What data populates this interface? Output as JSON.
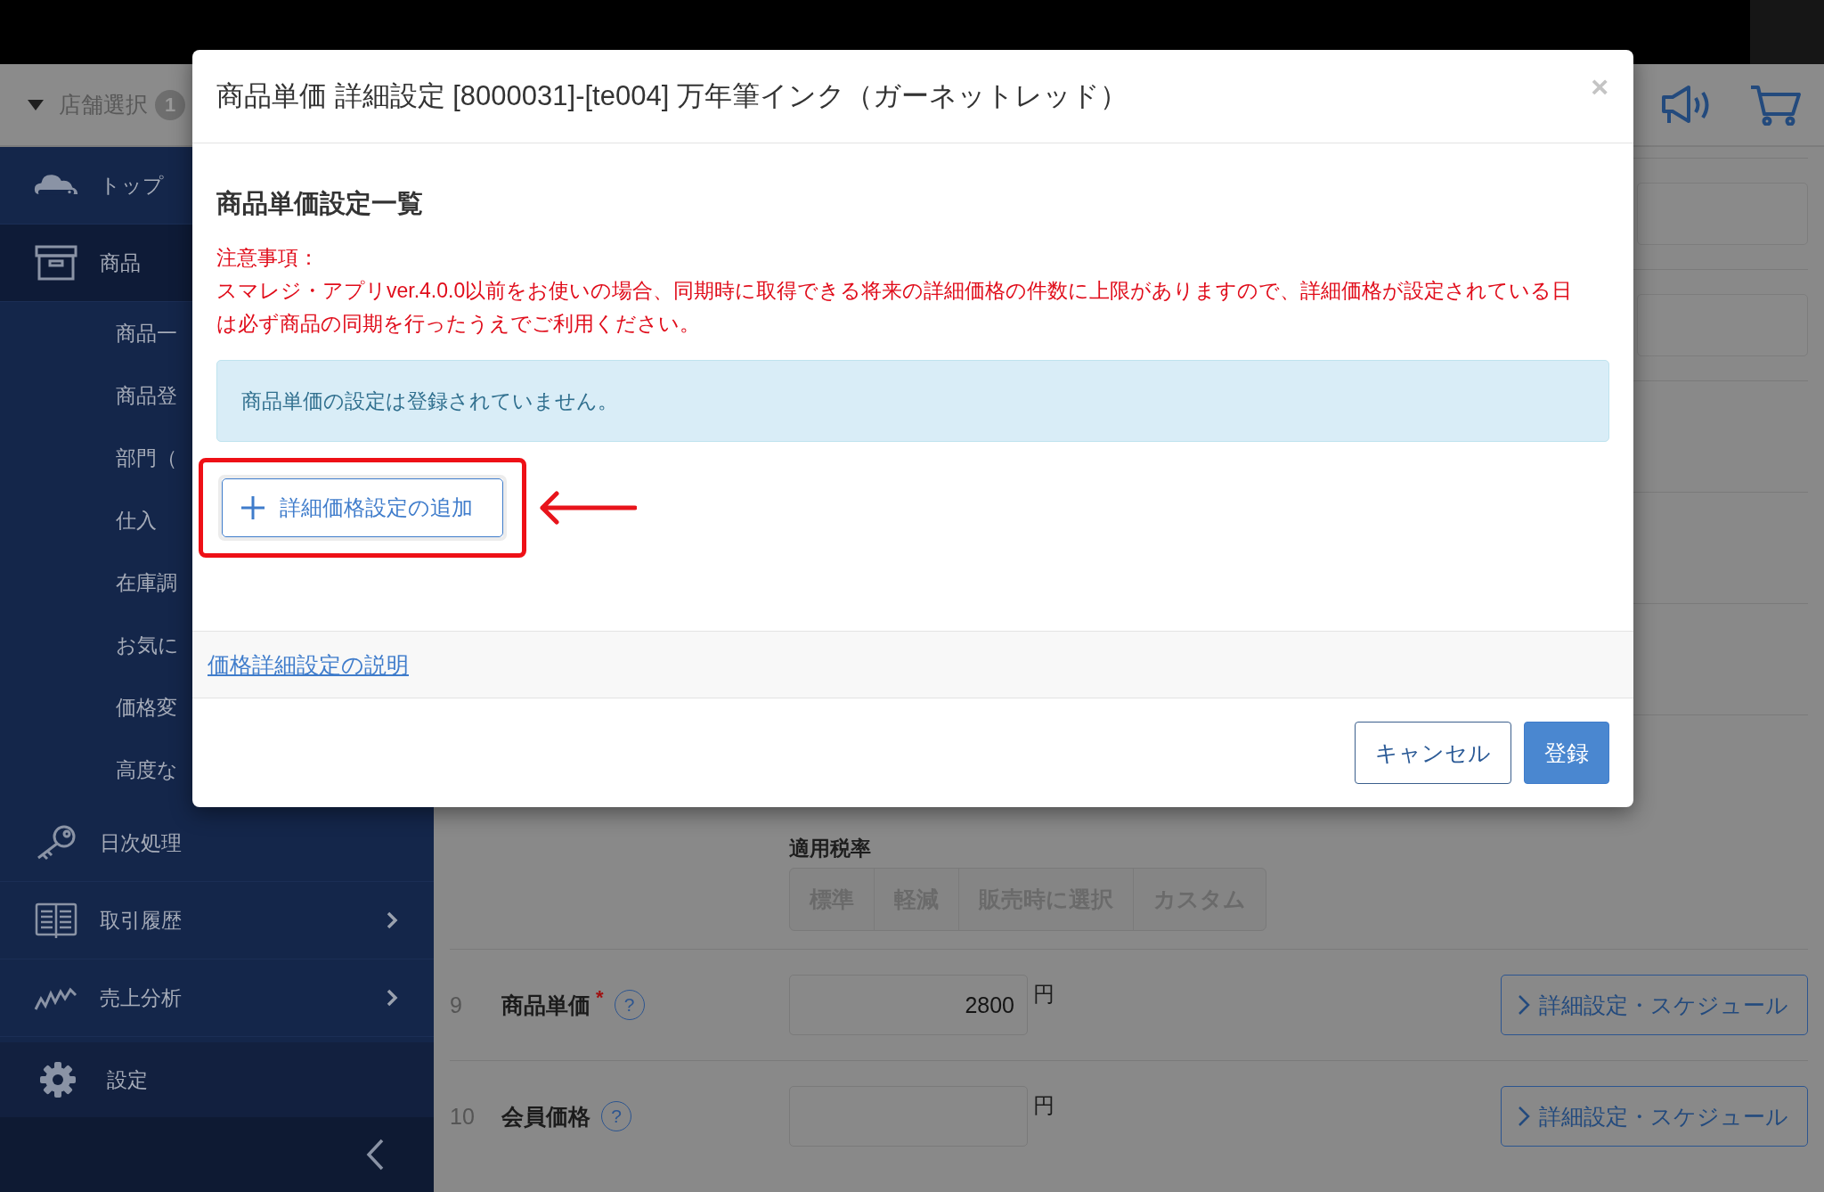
{
  "header": {
    "store_select": "店舗選択",
    "badge": "1"
  },
  "sidebar": {
    "items": [
      {
        "label": "トップ",
        "selected": false
      },
      {
        "label": "商品",
        "selected": true,
        "children": [
          {
            "label": "商品一",
            "selected": false
          },
          {
            "label": "商品登",
            "selected": false
          },
          {
            "label": "部門（",
            "selected": false
          },
          {
            "label": "仕入",
            "selected": false
          },
          {
            "label": "在庫調",
            "selected": false
          },
          {
            "label": "お気に",
            "selected": false
          },
          {
            "label": "価格変",
            "selected": false
          },
          {
            "label": "高度な",
            "selected": false
          }
        ]
      },
      {
        "label": "日次処理",
        "selected": false
      },
      {
        "label": "取引履歴",
        "selected": false,
        "has_submenu": true
      },
      {
        "label": "売上分析",
        "selected": false,
        "has_submenu": true
      }
    ],
    "settings": {
      "label": "設定"
    }
  },
  "form": {
    "tax_rate": {
      "label": "適用税率",
      "disabled": true,
      "options": [
        {
          "label": "標準",
          "selected": false
        },
        {
          "label": "軽減",
          "selected": false
        },
        {
          "label": "販売時に選択",
          "selected": false
        },
        {
          "label": "カスタム",
          "selected": false
        }
      ]
    },
    "rows": [
      {
        "number": "9",
        "label": "商品単価",
        "required_mark": "*",
        "help": "?",
        "value": "2800",
        "unit": "円",
        "detail_button": "詳細設定・スケジュール"
      },
      {
        "number": "10",
        "label": "会員価格",
        "help": "?",
        "unit": "円",
        "detail_button": "詳細設定・スケジュール"
      }
    ]
  },
  "modal": {
    "title": "商品単価 詳細設定 [8000031]-[te004] 万年筆インク（ガーネットレッド）",
    "close": "×",
    "heading": "商品単価設定一覧",
    "notice_title": "注意事項：",
    "notice_text": "スマレジ・アプリver.4.0.0以前をお使いの場合、同期時に取得できる将来の詳細価格の件数に上限がありますので、詳細価格が設定されている日は必ず商品の同期を行ったうえでご利用ください。",
    "info": "商品単価の設定は登録されていません。",
    "add_button": "詳細価格設定の追加",
    "help_link": "価格詳細設定の説明",
    "buttons": [
      {
        "label": "キャンセル",
        "kind": "default"
      },
      {
        "label": "登録",
        "kind": "primary"
      }
    ]
  }
}
